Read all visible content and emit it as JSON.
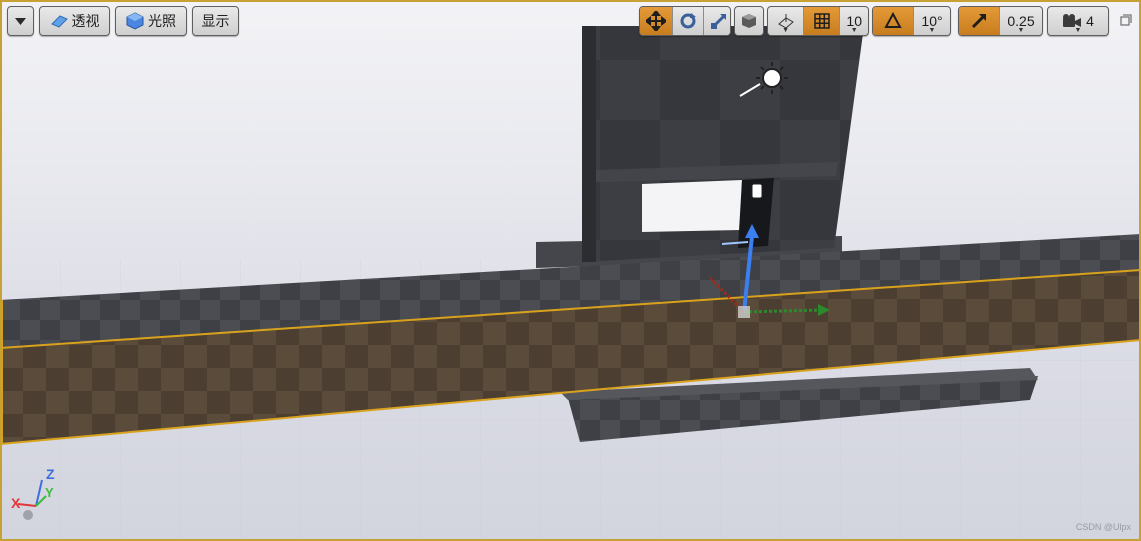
{
  "toolbar": {
    "menu_icon": "dropdown-caret-icon",
    "perspective_label": "透视",
    "lighting_label": "光照",
    "show_label": "显示",
    "grid_snap_value": "10",
    "rotation_snap_value": "10°",
    "scale_snap_value": "0.25",
    "camera_speed_value": "4"
  },
  "axis_indicator": {
    "z": "Z",
    "y": "Y",
    "x": "X"
  },
  "watermark": "CSDN @Ulpx",
  "colors": {
    "selection": "#d9a21c",
    "accent": "#d98a27"
  }
}
